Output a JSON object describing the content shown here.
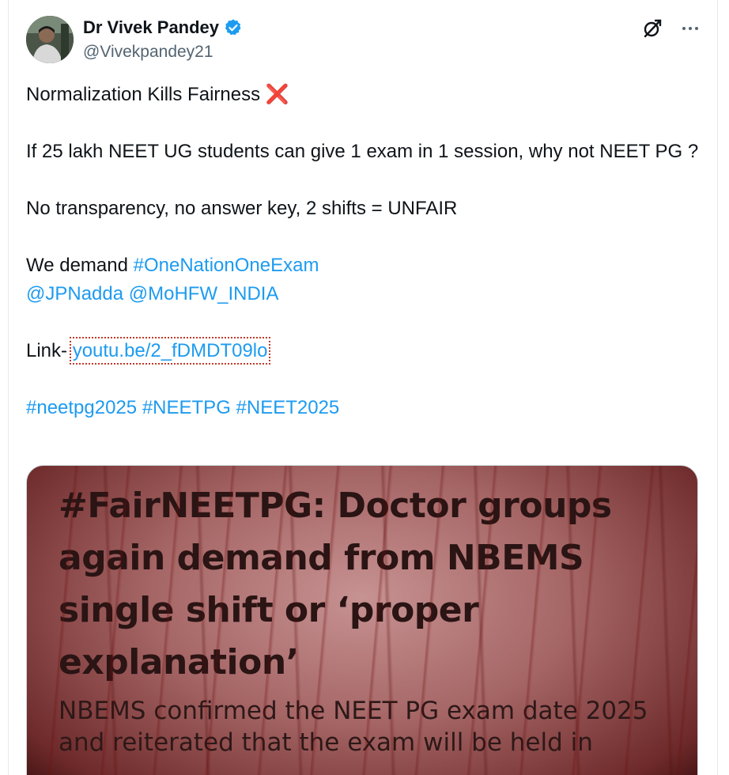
{
  "author": {
    "name": "Dr Vivek Pandey",
    "handle": "@Vivekpandey21",
    "verified_icon": "verified-badge-icon",
    "verified_color": "#1d9bf0"
  },
  "header_actions": {
    "grok_icon": "grok-icon",
    "more_icon": "more-icon"
  },
  "tweet": {
    "line1": "Normalization Kills Fairness",
    "line1_emoji": "❌",
    "line2": "If 25 lakh NEET UG students can give 1 exam in 1 session, why not NEET PG ?",
    "line3": "No transparency, no answer key, 2 shifts = UNFAIR",
    "line4_prefix": "We demand ",
    "hashtag_demand": "#OneNationOneExam",
    "mention1": "@JPNadda",
    "mention2": "@MoHFW_INDIA",
    "link_prefix": "Link- ",
    "link_text": "youtu.be/2_fDMDT09lo",
    "hashtags": [
      "#neetpg2025",
      "#NEETPG",
      "#NEET2025"
    ]
  },
  "media": {
    "headline": "#FairNEETPG: Doctor groups again demand from NBEMS single shift or ‘proper explanation’",
    "body": "NBEMS confirmed the NEET PG exam date 2025 and reiterated that the exam will be held in"
  },
  "colors": {
    "link": "#1d9bf0",
    "text": "#0f1419",
    "secondary": "#536471"
  }
}
